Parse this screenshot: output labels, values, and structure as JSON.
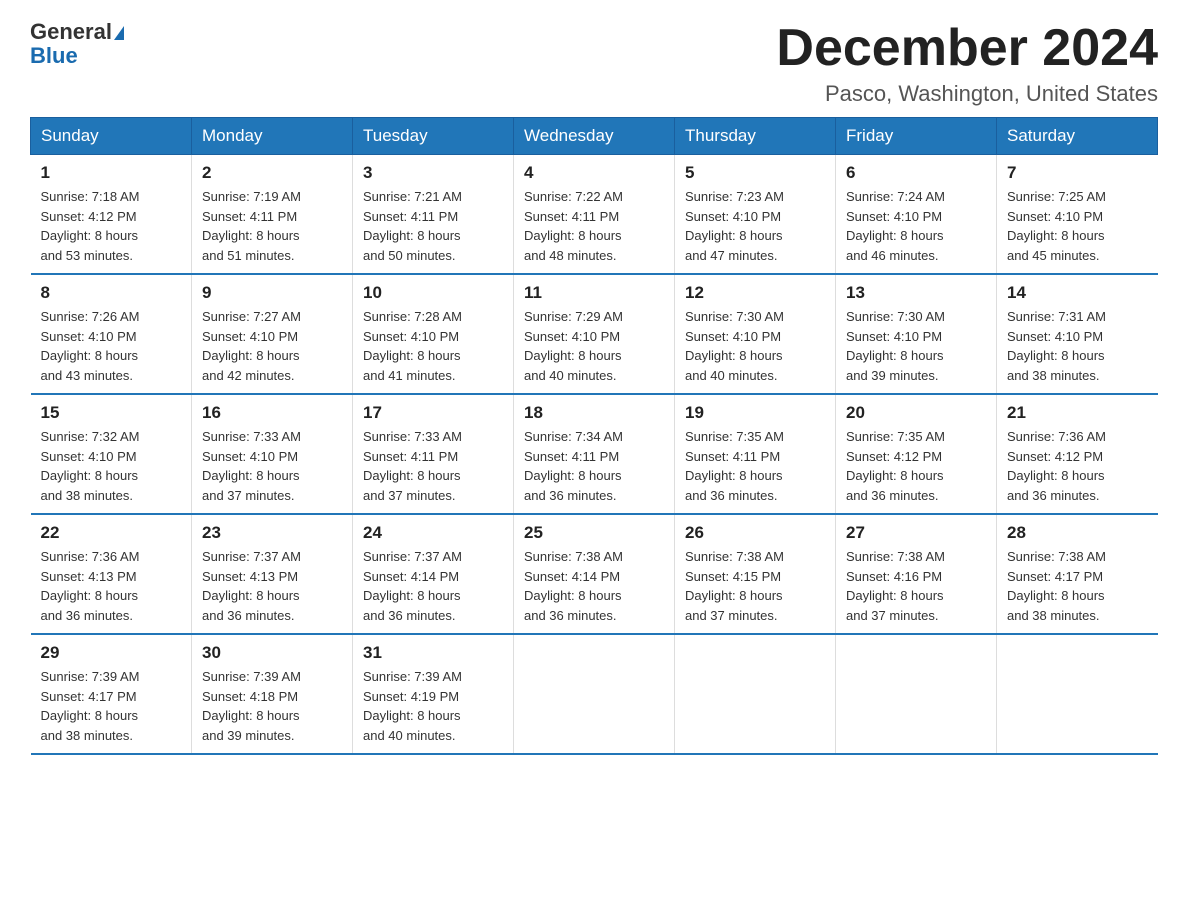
{
  "header": {
    "logo_line1": "General",
    "logo_line2": "Blue",
    "month_title": "December 2024",
    "location": "Pasco, Washington, United States"
  },
  "days_of_week": [
    "Sunday",
    "Monday",
    "Tuesday",
    "Wednesday",
    "Thursday",
    "Friday",
    "Saturday"
  ],
  "weeks": [
    [
      {
        "day": "1",
        "sunrise": "7:18 AM",
        "sunset": "4:12 PM",
        "daylight": "8 hours and 53 minutes."
      },
      {
        "day": "2",
        "sunrise": "7:19 AM",
        "sunset": "4:11 PM",
        "daylight": "8 hours and 51 minutes."
      },
      {
        "day": "3",
        "sunrise": "7:21 AM",
        "sunset": "4:11 PM",
        "daylight": "8 hours and 50 minutes."
      },
      {
        "day": "4",
        "sunrise": "7:22 AM",
        "sunset": "4:11 PM",
        "daylight": "8 hours and 48 minutes."
      },
      {
        "day": "5",
        "sunrise": "7:23 AM",
        "sunset": "4:10 PM",
        "daylight": "8 hours and 47 minutes."
      },
      {
        "day": "6",
        "sunrise": "7:24 AM",
        "sunset": "4:10 PM",
        "daylight": "8 hours and 46 minutes."
      },
      {
        "day": "7",
        "sunrise": "7:25 AM",
        "sunset": "4:10 PM",
        "daylight": "8 hours and 45 minutes."
      }
    ],
    [
      {
        "day": "8",
        "sunrise": "7:26 AM",
        "sunset": "4:10 PM",
        "daylight": "8 hours and 43 minutes."
      },
      {
        "day": "9",
        "sunrise": "7:27 AM",
        "sunset": "4:10 PM",
        "daylight": "8 hours and 42 minutes."
      },
      {
        "day": "10",
        "sunrise": "7:28 AM",
        "sunset": "4:10 PM",
        "daylight": "8 hours and 41 minutes."
      },
      {
        "day": "11",
        "sunrise": "7:29 AM",
        "sunset": "4:10 PM",
        "daylight": "8 hours and 40 minutes."
      },
      {
        "day": "12",
        "sunrise": "7:30 AM",
        "sunset": "4:10 PM",
        "daylight": "8 hours and 40 minutes."
      },
      {
        "day": "13",
        "sunrise": "7:30 AM",
        "sunset": "4:10 PM",
        "daylight": "8 hours and 39 minutes."
      },
      {
        "day": "14",
        "sunrise": "7:31 AM",
        "sunset": "4:10 PM",
        "daylight": "8 hours and 38 minutes."
      }
    ],
    [
      {
        "day": "15",
        "sunrise": "7:32 AM",
        "sunset": "4:10 PM",
        "daylight": "8 hours and 38 minutes."
      },
      {
        "day": "16",
        "sunrise": "7:33 AM",
        "sunset": "4:10 PM",
        "daylight": "8 hours and 37 minutes."
      },
      {
        "day": "17",
        "sunrise": "7:33 AM",
        "sunset": "4:11 PM",
        "daylight": "8 hours and 37 minutes."
      },
      {
        "day": "18",
        "sunrise": "7:34 AM",
        "sunset": "4:11 PM",
        "daylight": "8 hours and 36 minutes."
      },
      {
        "day": "19",
        "sunrise": "7:35 AM",
        "sunset": "4:11 PM",
        "daylight": "8 hours and 36 minutes."
      },
      {
        "day": "20",
        "sunrise": "7:35 AM",
        "sunset": "4:12 PM",
        "daylight": "8 hours and 36 minutes."
      },
      {
        "day": "21",
        "sunrise": "7:36 AM",
        "sunset": "4:12 PM",
        "daylight": "8 hours and 36 minutes."
      }
    ],
    [
      {
        "day": "22",
        "sunrise": "7:36 AM",
        "sunset": "4:13 PM",
        "daylight": "8 hours and 36 minutes."
      },
      {
        "day": "23",
        "sunrise": "7:37 AM",
        "sunset": "4:13 PM",
        "daylight": "8 hours and 36 minutes."
      },
      {
        "day": "24",
        "sunrise": "7:37 AM",
        "sunset": "4:14 PM",
        "daylight": "8 hours and 36 minutes."
      },
      {
        "day": "25",
        "sunrise": "7:38 AM",
        "sunset": "4:14 PM",
        "daylight": "8 hours and 36 minutes."
      },
      {
        "day": "26",
        "sunrise": "7:38 AM",
        "sunset": "4:15 PM",
        "daylight": "8 hours and 37 minutes."
      },
      {
        "day": "27",
        "sunrise": "7:38 AM",
        "sunset": "4:16 PM",
        "daylight": "8 hours and 37 minutes."
      },
      {
        "day": "28",
        "sunrise": "7:38 AM",
        "sunset": "4:17 PM",
        "daylight": "8 hours and 38 minutes."
      }
    ],
    [
      {
        "day": "29",
        "sunrise": "7:39 AM",
        "sunset": "4:17 PM",
        "daylight": "8 hours and 38 minutes."
      },
      {
        "day": "30",
        "sunrise": "7:39 AM",
        "sunset": "4:18 PM",
        "daylight": "8 hours and 39 minutes."
      },
      {
        "day": "31",
        "sunrise": "7:39 AM",
        "sunset": "4:19 PM",
        "daylight": "8 hours and 40 minutes."
      },
      null,
      null,
      null,
      null
    ]
  ],
  "labels": {
    "sunrise": "Sunrise:",
    "sunset": "Sunset:",
    "daylight": "Daylight:"
  }
}
